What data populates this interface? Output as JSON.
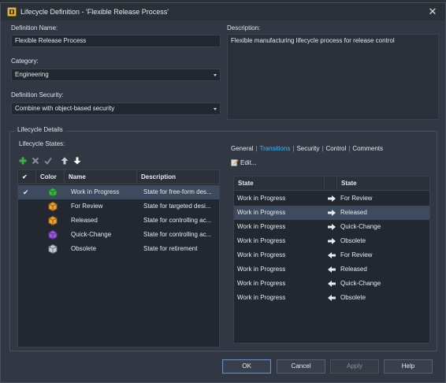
{
  "window": {
    "title": "Lifecycle Definition - 'Flexible Release Process'"
  },
  "form": {
    "definition_name_label": "Definition Name:",
    "definition_name_value": "Flexible Release Process",
    "category_label": "Category:",
    "category_value": "Engineering",
    "security_label": "Definition Security:",
    "security_value": "Combine with object-based security",
    "description_label": "Description:",
    "description_value": "Flexible manufacturing lifecycle process for release control"
  },
  "details": {
    "group_title": "Lifecycle Details",
    "states_label": "Lifecycle States:",
    "toolbar_icons": [
      "add-icon",
      "delete-icon",
      "check-icon",
      "move-up-icon",
      "move-down-icon"
    ],
    "states_table": {
      "headers": [
        "",
        "Color",
        "Name",
        "Description"
      ],
      "rows": [
        {
          "default": true,
          "name": "Work in Progress",
          "description": "State for free-form des...",
          "color": "#3fae49",
          "selected": true
        },
        {
          "default": false,
          "name": "For Review",
          "description": "State for targeted desi...",
          "color": "#e8a33a",
          "selected": false
        },
        {
          "default": false,
          "name": "Released",
          "description": "State for controlling ac...",
          "color": "#e8a33a",
          "selected": false
        },
        {
          "default": false,
          "name": "Quick-Change",
          "description": "State for controlling ac...",
          "color": "#9b59d6",
          "selected": false
        },
        {
          "default": false,
          "name": "Obsolete",
          "description": "State for retirement",
          "color": "#c9ccd2",
          "selected": false
        }
      ]
    },
    "tabs": [
      {
        "label": "General",
        "active": false
      },
      {
        "label": "Transitions",
        "active": true
      },
      {
        "label": "Security",
        "active": false
      },
      {
        "label": "Control",
        "active": false
      },
      {
        "label": "Comments",
        "active": false
      }
    ],
    "edit_label": "Edit...",
    "transitions_table": {
      "headers": [
        "State",
        "",
        "State"
      ],
      "rows": [
        {
          "from": "Work in Progress",
          "direction": "right",
          "to": "For Review",
          "selected": false
        },
        {
          "from": "Work in Progress",
          "direction": "right",
          "to": "Released",
          "selected": true
        },
        {
          "from": "Work in Progress",
          "direction": "right",
          "to": "Quick-Change",
          "selected": false
        },
        {
          "from": "Work in Progress",
          "direction": "right",
          "to": "Obsolete",
          "selected": false
        },
        {
          "from": "Work in Progress",
          "direction": "left",
          "to": "For Review",
          "selected": false
        },
        {
          "from": "Work in Progress",
          "direction": "left",
          "to": "Released",
          "selected": false
        },
        {
          "from": "Work in Progress",
          "direction": "left",
          "to": "Quick-Change",
          "selected": false
        },
        {
          "from": "Work in Progress",
          "direction": "left",
          "to": "Obsolete",
          "selected": false
        }
      ]
    }
  },
  "buttons": {
    "ok": "OK",
    "cancel": "Cancel",
    "apply": "Apply",
    "help": "Help"
  },
  "colors": {
    "accent": "#4fb0ea",
    "selection": "#3e4a5d",
    "add_green": "#3fae49"
  }
}
